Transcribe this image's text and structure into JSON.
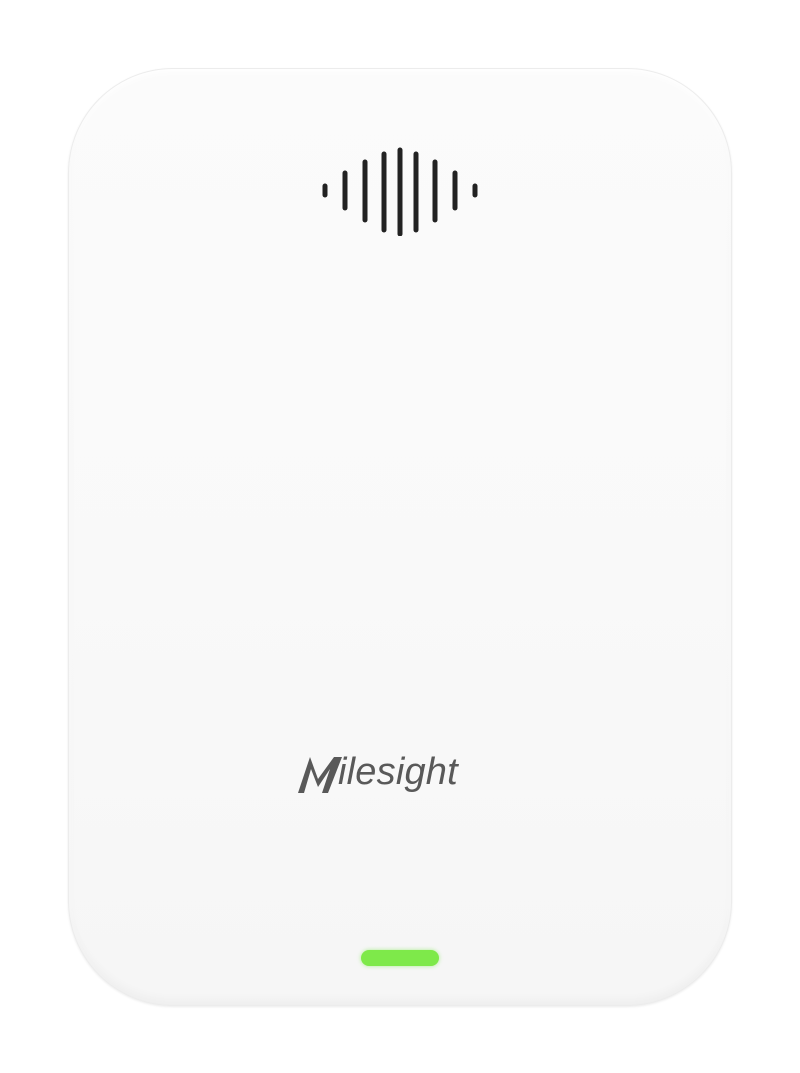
{
  "device": {
    "brand_text": "ilesight",
    "brand_logo_initial": "M",
    "led_color": "#7ee94a",
    "body_color": "#f9f9f9",
    "wave_icon_color": "#222222",
    "logo_color": "#595959"
  }
}
